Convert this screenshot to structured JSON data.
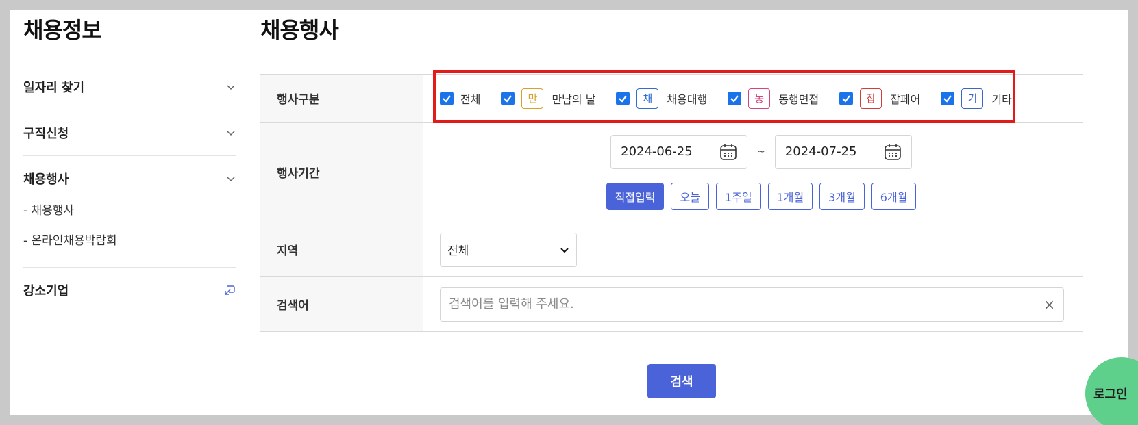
{
  "sidebar": {
    "title": "채용정보",
    "groups": [
      {
        "label": "일자리 찾기"
      },
      {
        "label": "구직신청"
      },
      {
        "label": "채용행사",
        "subitems": [
          "- 채용행사",
          "- 온라인채용박람회"
        ]
      },
      {
        "label": "강소기업"
      }
    ]
  },
  "main": {
    "title": "채용행사",
    "labels": {
      "event_type": "행사구분",
      "period": "행사기간",
      "region": "지역",
      "keyword": "검색어"
    },
    "event_types": [
      {
        "label": "전체",
        "checked": true
      },
      {
        "tag": "만",
        "label": "만남의 날",
        "tag_color": "#d9a12b",
        "checked": true
      },
      {
        "tag": "채",
        "label": "채용대행",
        "tag_color": "#2f6fd0",
        "checked": true
      },
      {
        "tag": "동",
        "label": "동행면접",
        "tag_color": "#d6457a",
        "checked": true
      },
      {
        "tag": "잡",
        "label": "잡페어",
        "tag_color": "#d23c3c",
        "checked": true
      },
      {
        "tag": "기",
        "label": "기타",
        "tag_color": "#3c67c8",
        "checked": true
      }
    ],
    "date_start": "2024-06-25",
    "date_end": "2024-07-25",
    "tilde": "~",
    "quick_buttons": [
      "직접입력",
      "오늘",
      "1주일",
      "1개월",
      "3개월",
      "6개월"
    ],
    "active_quick": "직접입력",
    "region_selected": "전체",
    "keyword_placeholder": "검색어를 입력해 주세요.",
    "clear_symbol": "×",
    "search_button": "검색"
  },
  "login_button": "로그인",
  "colors": {
    "primary": "#4b63d8",
    "login_bg": "#5fd08c",
    "highlight": "#e21a1a",
    "checkbox": "#1a73e8"
  },
  "icons": {
    "chevron": "chevron-down-icon",
    "calendar": "calendar-icon",
    "external": "external-link-icon"
  }
}
